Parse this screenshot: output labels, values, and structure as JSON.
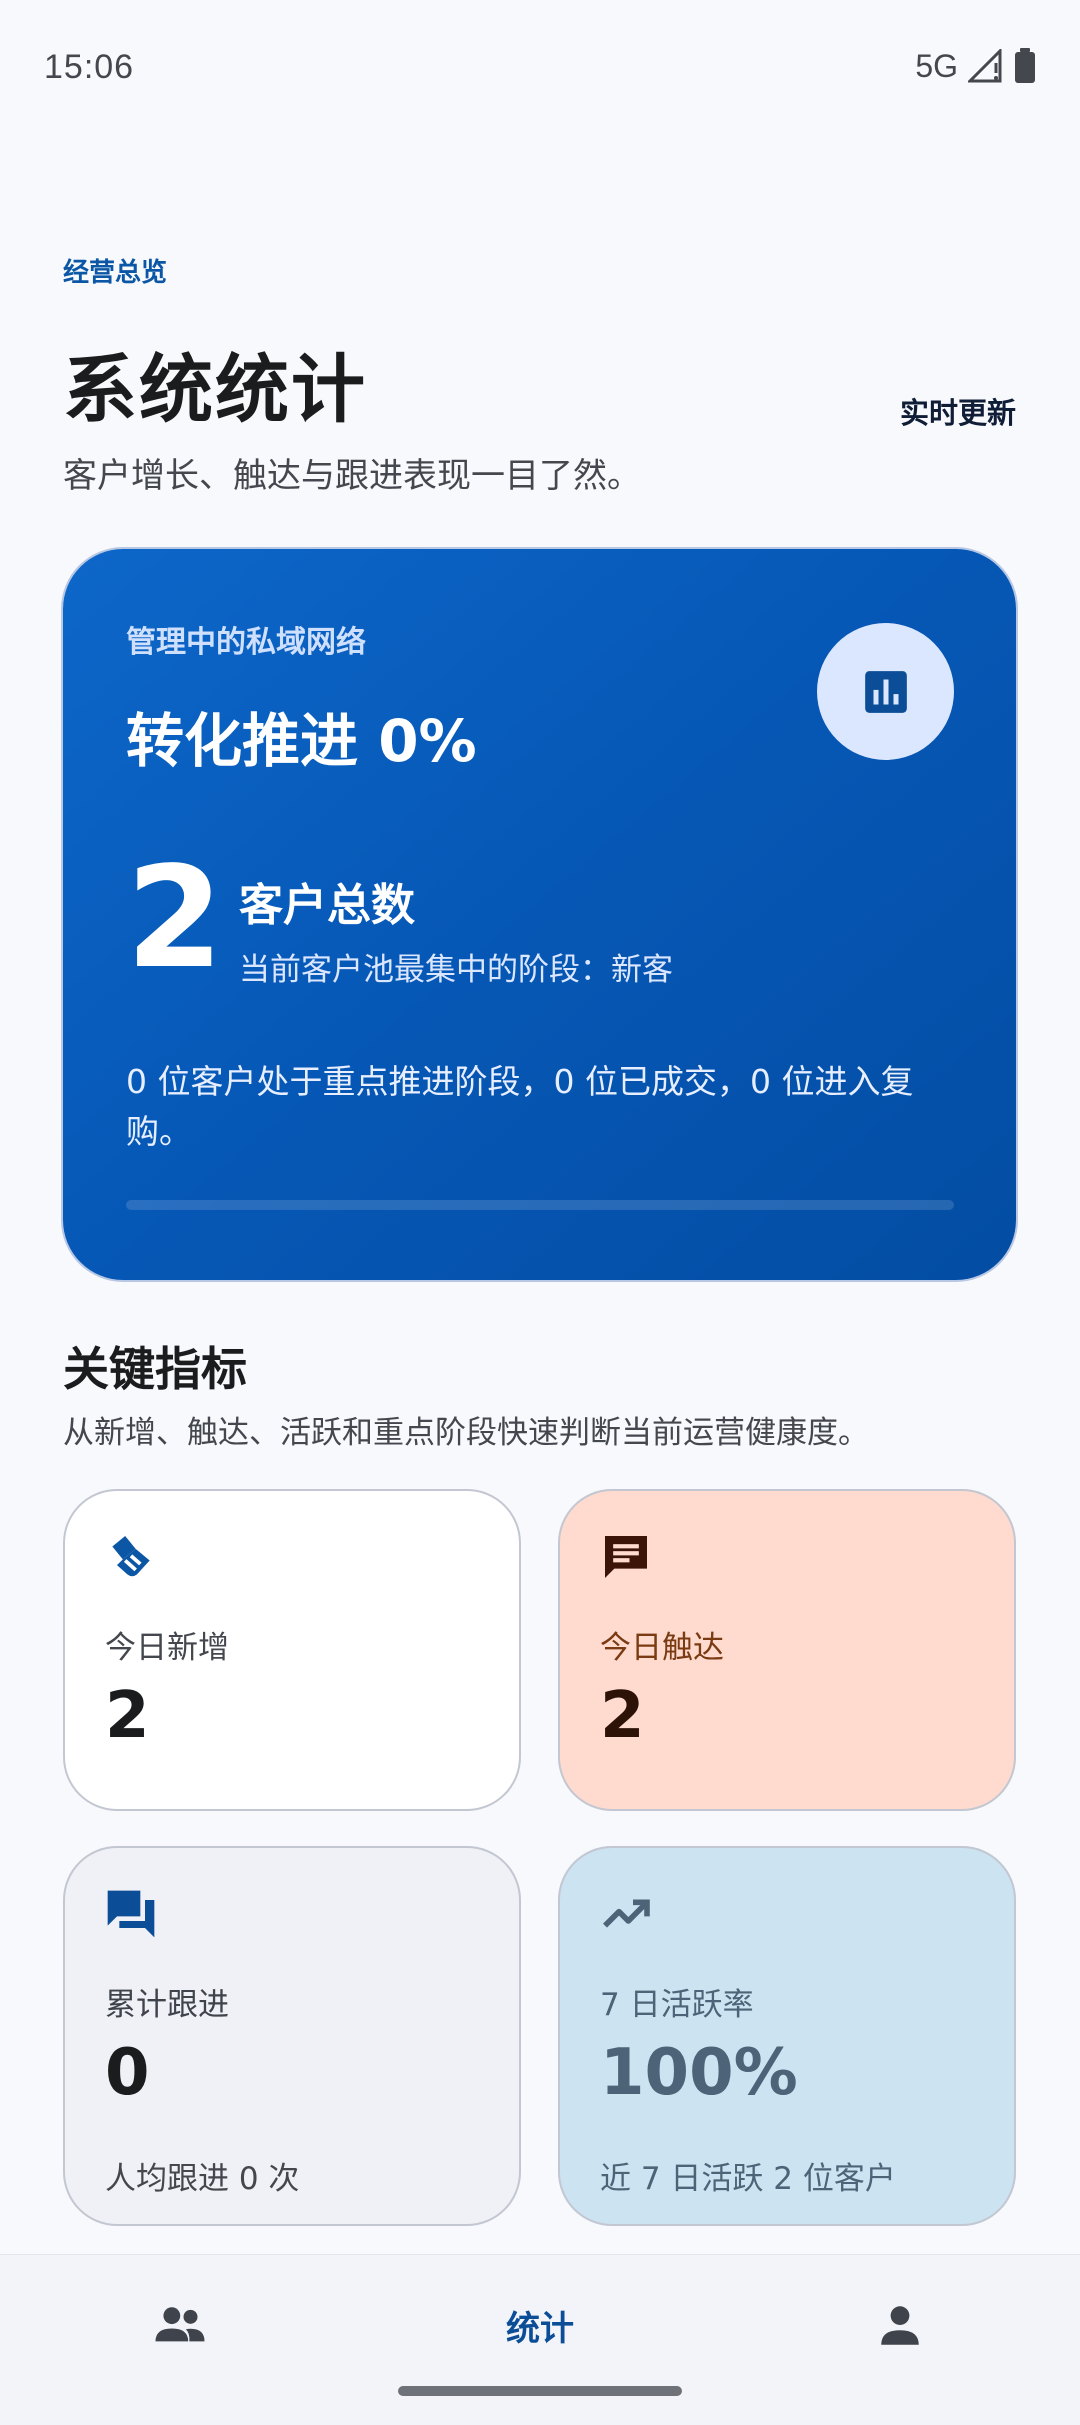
{
  "status_bar": {
    "time": "15:06",
    "network": "5G"
  },
  "header": {
    "eyebrow": "经营总览",
    "title": "系统统计",
    "live_update": "实时更新",
    "subtitle": "客户增长、触达与跟进表现一目了然。"
  },
  "hero": {
    "eyebrow": "管理中的私域网络",
    "title": "转化推进 0%",
    "total_value": "2",
    "total_label": "客户总数",
    "total_sub": "当前客户池最集中的阶段：新客",
    "description": "0 位客户处于重点推进阶段，0 位已成交，0 位进入复购。",
    "progress_percent": 0,
    "icon": "bar-chart-icon"
  },
  "metrics_section": {
    "title": "关键指标",
    "subtitle": "从新增、触达、活跃和重点阶段快速判断当前运营健康度。",
    "cards": [
      {
        "label": "今日新增",
        "value": "2",
        "icon": "handshake-icon"
      },
      {
        "label": "今日触达",
        "value": "2",
        "icon": "chat-icon"
      },
      {
        "label": "累计跟进",
        "value": "0",
        "note": "人均跟进 0 次",
        "icon": "forum-icon"
      },
      {
        "label": "7 日活跃率",
        "value": "100%",
        "note": "近 7 日活跃 2 位客户",
        "icon": "trending-up-icon"
      }
    ]
  },
  "bottom_nav": {
    "items": [
      {
        "id": "customers",
        "icon": "people-icon",
        "label": ""
      },
      {
        "id": "stats",
        "icon": "",
        "label": "统计",
        "active": true
      },
      {
        "id": "profile",
        "icon": "person-icon",
        "label": ""
      }
    ]
  },
  "colors": {
    "primary": "#0b57a6",
    "hero_bg": "#0657b5",
    "touch_card": "#ffdbcf",
    "active_card": "#cce3f1"
  }
}
